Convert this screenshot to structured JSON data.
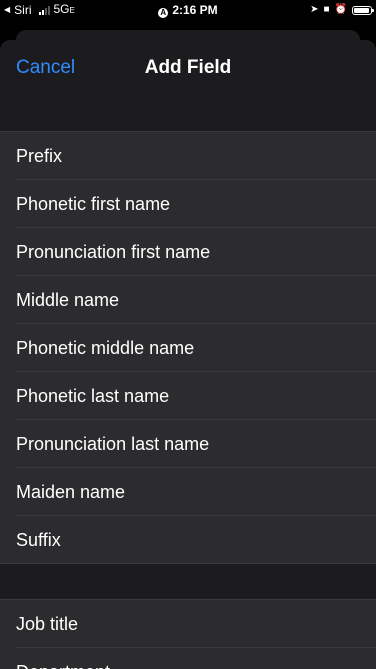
{
  "status_bar": {
    "back_app": "Siri",
    "network": "5G",
    "network_suffix": "E",
    "time": "2:16 PM"
  },
  "nav": {
    "cancel_label": "Cancel",
    "title": "Add Field"
  },
  "group1": {
    "items": [
      {
        "label": "Prefix"
      },
      {
        "label": "Phonetic first name"
      },
      {
        "label": "Pronunciation first name"
      },
      {
        "label": "Middle name"
      },
      {
        "label": "Phonetic middle name"
      },
      {
        "label": "Phonetic last name"
      },
      {
        "label": "Pronunciation last name"
      },
      {
        "label": "Maiden name"
      },
      {
        "label": "Suffix"
      }
    ]
  },
  "group2": {
    "items": [
      {
        "label": "Job title"
      },
      {
        "label": "Department"
      }
    ]
  },
  "colors": {
    "accent": "#2f8cff",
    "sheet_background": "#1c1c1e",
    "row_background": "#2c2c2e",
    "separator": "#3a3a3c"
  }
}
